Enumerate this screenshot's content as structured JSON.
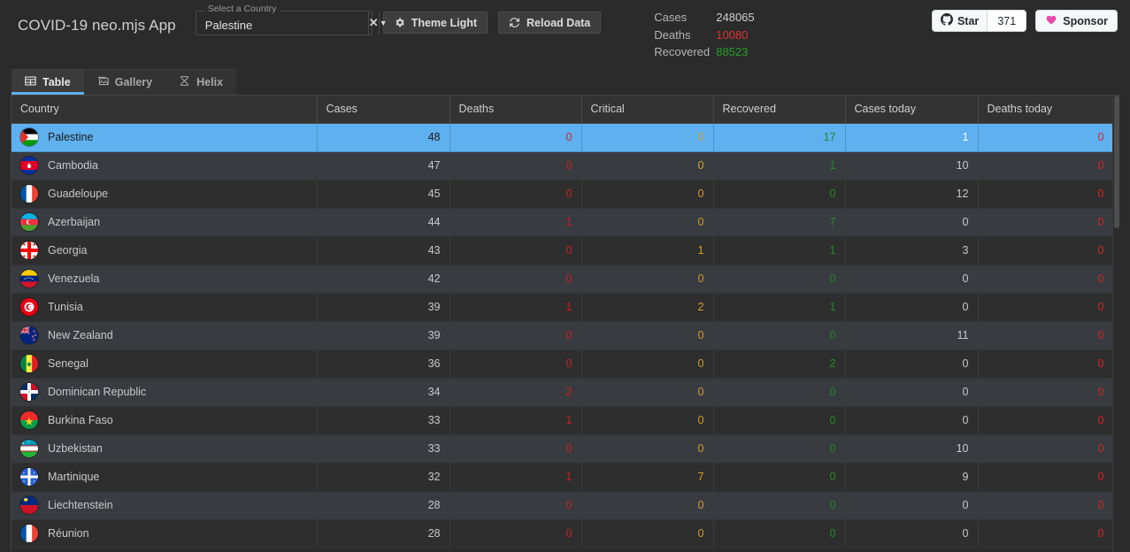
{
  "header": {
    "app_title": "COVID-19 neo.mjs App",
    "combobox": {
      "legend": "Select a Country",
      "value": "Palestine",
      "placeholder": "Select a Country",
      "clear_icon": "close-icon",
      "arrow_icon": "chevron-down-icon"
    },
    "buttons": [
      {
        "label": "Theme Light",
        "icon": "gear-icon"
      },
      {
        "label": "Reload Data",
        "icon": "refresh-icon"
      }
    ],
    "stats": [
      {
        "label": "Cases",
        "value": "248065",
        "color": "#cfcfcf"
      },
      {
        "label": "Deaths",
        "value": "10080",
        "color": "#e03030"
      },
      {
        "label": "Recovered",
        "value": "88523",
        "color": "#25a02a"
      }
    ],
    "github": {
      "star_label": "Star",
      "star_icon": "github-icon",
      "star_count": "371",
      "sponsor_label": "Sponsor",
      "sponsor_icon": "heart-icon",
      "sponsor_color": "#ea4aaa"
    }
  },
  "tabs": [
    {
      "label": "Table",
      "icon": "table-icon",
      "active": true
    },
    {
      "label": "Gallery",
      "icon": "gallery-icon",
      "active": false
    },
    {
      "label": "Helix",
      "icon": "helix-icon",
      "active": false
    }
  ],
  "table": {
    "columns": [
      "Country",
      "Cases",
      "Deaths",
      "Critical",
      "Recovered",
      "Cases today",
      "Deaths today"
    ],
    "selected_row": "Palestine",
    "rows": [
      {
        "country": "Palestine",
        "flag": "ps",
        "cases": "48",
        "deaths": "0",
        "critical": "0",
        "recovered": "17",
        "cases_today": "1",
        "deaths_today": "0"
      },
      {
        "country": "Cambodia",
        "flag": "kh",
        "cases": "47",
        "deaths": "0",
        "critical": "0",
        "recovered": "1",
        "cases_today": "10",
        "deaths_today": "0"
      },
      {
        "country": "Guadeloupe",
        "flag": "gp",
        "cases": "45",
        "deaths": "0",
        "critical": "0",
        "recovered": "0",
        "cases_today": "12",
        "deaths_today": "0"
      },
      {
        "country": "Azerbaijan",
        "flag": "az",
        "cases": "44",
        "deaths": "1",
        "critical": "0",
        "recovered": "7",
        "cases_today": "0",
        "deaths_today": "0"
      },
      {
        "country": "Georgia",
        "flag": "ge",
        "cases": "43",
        "deaths": "0",
        "critical": "1",
        "recovered": "1",
        "cases_today": "3",
        "deaths_today": "0"
      },
      {
        "country": "Venezuela",
        "flag": "ve",
        "cases": "42",
        "deaths": "0",
        "critical": "0",
        "recovered": "0",
        "cases_today": "0",
        "deaths_today": "0"
      },
      {
        "country": "Tunisia",
        "flag": "tn",
        "cases": "39",
        "deaths": "1",
        "critical": "2",
        "recovered": "1",
        "cases_today": "0",
        "deaths_today": "0"
      },
      {
        "country": "New Zealand",
        "flag": "nz",
        "cases": "39",
        "deaths": "0",
        "critical": "0",
        "recovered": "0",
        "cases_today": "11",
        "deaths_today": "0"
      },
      {
        "country": "Senegal",
        "flag": "sn",
        "cases": "36",
        "deaths": "0",
        "critical": "0",
        "recovered": "2",
        "cases_today": "0",
        "deaths_today": "0"
      },
      {
        "country": "Dominican Republic",
        "flag": "do",
        "cases": "34",
        "deaths": "2",
        "critical": "0",
        "recovered": "0",
        "cases_today": "0",
        "deaths_today": "0"
      },
      {
        "country": "Burkina Faso",
        "flag": "bf",
        "cases": "33",
        "deaths": "1",
        "critical": "0",
        "recovered": "0",
        "cases_today": "0",
        "deaths_today": "0"
      },
      {
        "country": "Uzbekistan",
        "flag": "uz",
        "cases": "33",
        "deaths": "0",
        "critical": "0",
        "recovered": "0",
        "cases_today": "10",
        "deaths_today": "0"
      },
      {
        "country": "Martinique",
        "flag": "mq",
        "cases": "32",
        "deaths": "1",
        "critical": "7",
        "recovered": "0",
        "cases_today": "9",
        "deaths_today": "0"
      },
      {
        "country": "Liechtenstein",
        "flag": "li",
        "cases": "28",
        "deaths": "0",
        "critical": "0",
        "recovered": "0",
        "cases_today": "0",
        "deaths_today": "0"
      },
      {
        "country": "Réunion",
        "flag": "re",
        "cases": "28",
        "deaths": "0",
        "critical": "0",
        "recovered": "0",
        "cases_today": "0",
        "deaths_today": "0"
      }
    ]
  },
  "colors": {
    "accent": "#5fb0ef",
    "deaths": "#cc2222",
    "critical": "#d79a24",
    "recovered": "#23892a",
    "background": "#2b2b2b"
  }
}
